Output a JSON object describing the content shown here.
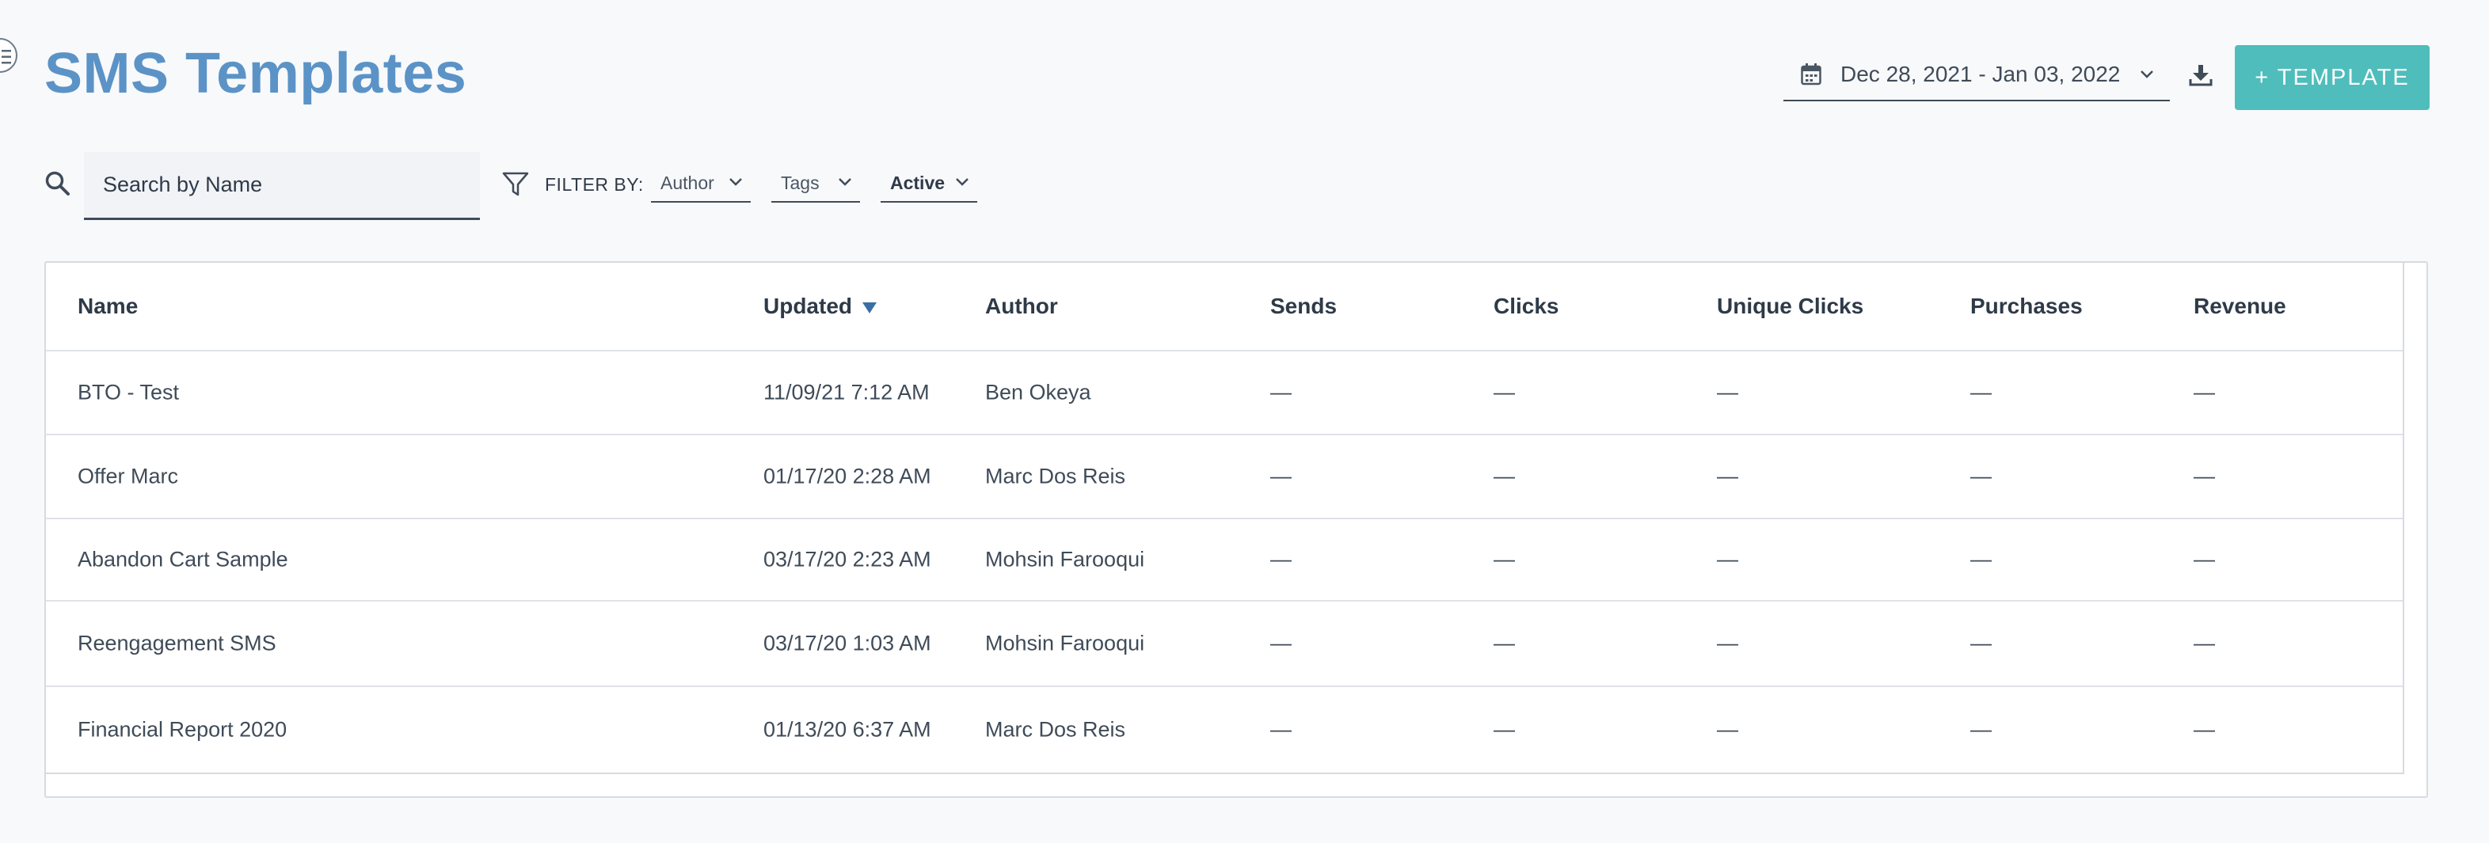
{
  "header": {
    "title": "SMS Templates",
    "date_range": "Dec 28, 2021 - Jan 03, 2022",
    "add_button_label": "+ TEMPLATE"
  },
  "filters": {
    "search_placeholder": "Search by Name",
    "filter_by_label": "FILTER BY:",
    "author_label": "Author",
    "tags_label": "Tags",
    "status_label": "Active"
  },
  "table": {
    "columns": {
      "name": "Name",
      "updated": "Updated",
      "author": "Author",
      "sends": "Sends",
      "clicks": "Clicks",
      "unique_clicks": "Unique Clicks",
      "purchases": "Purchases",
      "revenue": "Revenue"
    },
    "rows": [
      {
        "name": "BTO - Test",
        "updated": "11/09/21 7:12 AM",
        "author": "Ben Okeya",
        "sends": "—",
        "clicks": "—",
        "unique_clicks": "—",
        "purchases": "—",
        "revenue": "—"
      },
      {
        "name": "Offer Marc",
        "updated": "01/17/20 2:28 AM",
        "author": "Marc Dos Reis",
        "sends": "—",
        "clicks": "—",
        "unique_clicks": "—",
        "purchases": "—",
        "revenue": "—"
      },
      {
        "name": "Abandon Cart Sample",
        "updated": "03/17/20 2:23 AM",
        "author": "Mohsin Farooqui",
        "sends": "—",
        "clicks": "—",
        "unique_clicks": "—",
        "purchases": "—",
        "revenue": "—"
      },
      {
        "name": "Reengagement SMS",
        "updated": "03/17/20 1:03 AM",
        "author": "Mohsin Farooqui",
        "sends": "—",
        "clicks": "—",
        "unique_clicks": "—",
        "purchases": "—",
        "revenue": "—"
      },
      {
        "name": "Financial Report 2020",
        "updated": "01/13/20 6:37 AM",
        "author": "Marc Dos Reis",
        "sends": "—",
        "clicks": "—",
        "unique_clicks": "—",
        "purchases": "—",
        "revenue": "—"
      }
    ]
  },
  "icons": {
    "menu": "menu-icon",
    "calendar": "calendar-icon",
    "chevron": "chevron-down-icon",
    "download": "download-icon",
    "search": "search-icon",
    "filter": "filter-icon",
    "sort": "sort-desc-icon"
  },
  "colors": {
    "title": "#5b93c7",
    "accent_button": "#4fbdbb",
    "text": "#2f3a48",
    "background": "#f8f9fb"
  }
}
